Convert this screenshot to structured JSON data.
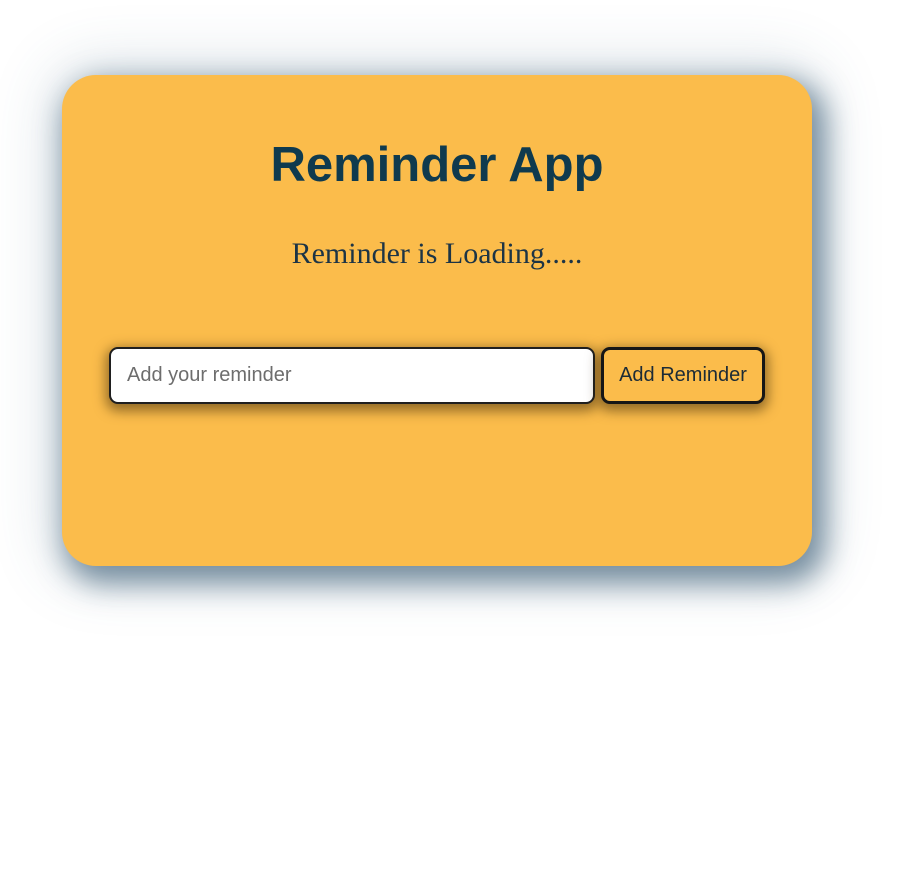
{
  "app": {
    "title": "Reminder App",
    "status": "Reminder is Loading....."
  },
  "form": {
    "input_placeholder": "Add your reminder",
    "input_value": "",
    "add_label": "Add Reminder"
  },
  "colors": {
    "card_background": "#fbbc4b",
    "heading_text": "#0f3a4e",
    "shadow": "#19415f"
  }
}
